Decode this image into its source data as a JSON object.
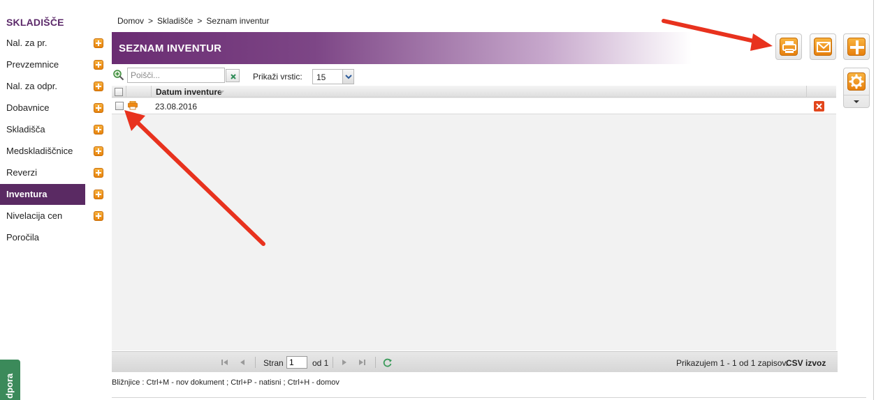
{
  "sidebar": {
    "title": "SKLADIŠČE",
    "items": [
      {
        "label": "Nal. za pr.",
        "has_add": true,
        "active": false
      },
      {
        "label": "Prevzemnice",
        "has_add": true,
        "active": false
      },
      {
        "label": "Nal. za odpr.",
        "has_add": true,
        "active": false
      },
      {
        "label": "Dobavnice",
        "has_add": true,
        "active": false
      },
      {
        "label": "Skladišča",
        "has_add": true,
        "active": false
      },
      {
        "label": "Medskladiščnice",
        "has_add": true,
        "active": false
      },
      {
        "label": "Reverzi",
        "has_add": true,
        "active": false
      },
      {
        "label": "Inventura",
        "has_add": true,
        "active": true
      },
      {
        "label": "Nivelacija cen",
        "has_add": true,
        "active": false
      },
      {
        "label": "Poročila",
        "has_add": false,
        "active": false
      }
    ],
    "support_tab": "dpora"
  },
  "breadcrumb": {
    "items": [
      "Domov",
      "Skladišče",
      "Seznam inventur"
    ],
    "separator": ">"
  },
  "header": {
    "title": "SEZNAM INVENTUR"
  },
  "actions": {
    "icons": [
      "printer-icon",
      "mail-icon",
      "plus-icon",
      "gear-icon"
    ]
  },
  "toolbar": {
    "search_placeholder": "Poišči...",
    "search_value": "",
    "rows_label": "Prikaži vrstic:",
    "rows_value": "15"
  },
  "grid": {
    "columns": [
      "Datum inventure"
    ],
    "rows": [
      {
        "date": "23.08.2016"
      }
    ]
  },
  "pager": {
    "page_label": "Stran",
    "page_value": "1",
    "of_label": "od 1",
    "records_text": "Prikazujem 1 - 1 od 1 zapisov.",
    "csv_label": "CSV izvoz"
  },
  "footer": {
    "shortcuts": "Bližnjice : Ctrl+M - nov dokument ;  Ctrl+P - natisni ;  Ctrl+H - domov"
  },
  "colors": {
    "brand_purple": "#5a2a63",
    "accent_orange": "#f08a14",
    "annotation_red": "#e8321e"
  }
}
